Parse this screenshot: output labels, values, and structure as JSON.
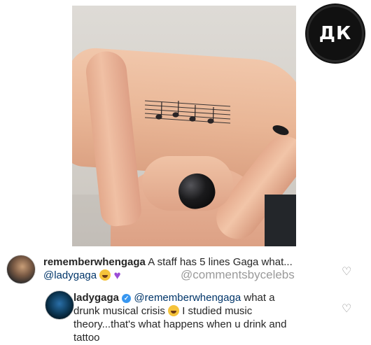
{
  "logo": {
    "text": "ДК"
  },
  "comments": [
    {
      "username": "rememberwhengaga",
      "text_line1": "A staff has 5 lines Gaga what...",
      "mention": "@ladygaga",
      "emojis": [
        "face-with-tears-of-joy",
        "purple-heart"
      ],
      "verified": false
    },
    {
      "username": "ladygaga",
      "verified": true,
      "mention": "@rememberwhengaga",
      "text_a": " what a",
      "text_line2": "drunk musical crisis",
      "text_line2b": " I studied music",
      "text_line3": "theory...that's what happens when u drink and",
      "text_line4": "tattoo"
    }
  ],
  "watermark": "@commentsbycelebs",
  "icons": {
    "like": "heart-outline-icon"
  },
  "colors": {
    "verified": "#3897f0",
    "mention": "#003569",
    "heart_emoji": "#9b4cd6"
  }
}
